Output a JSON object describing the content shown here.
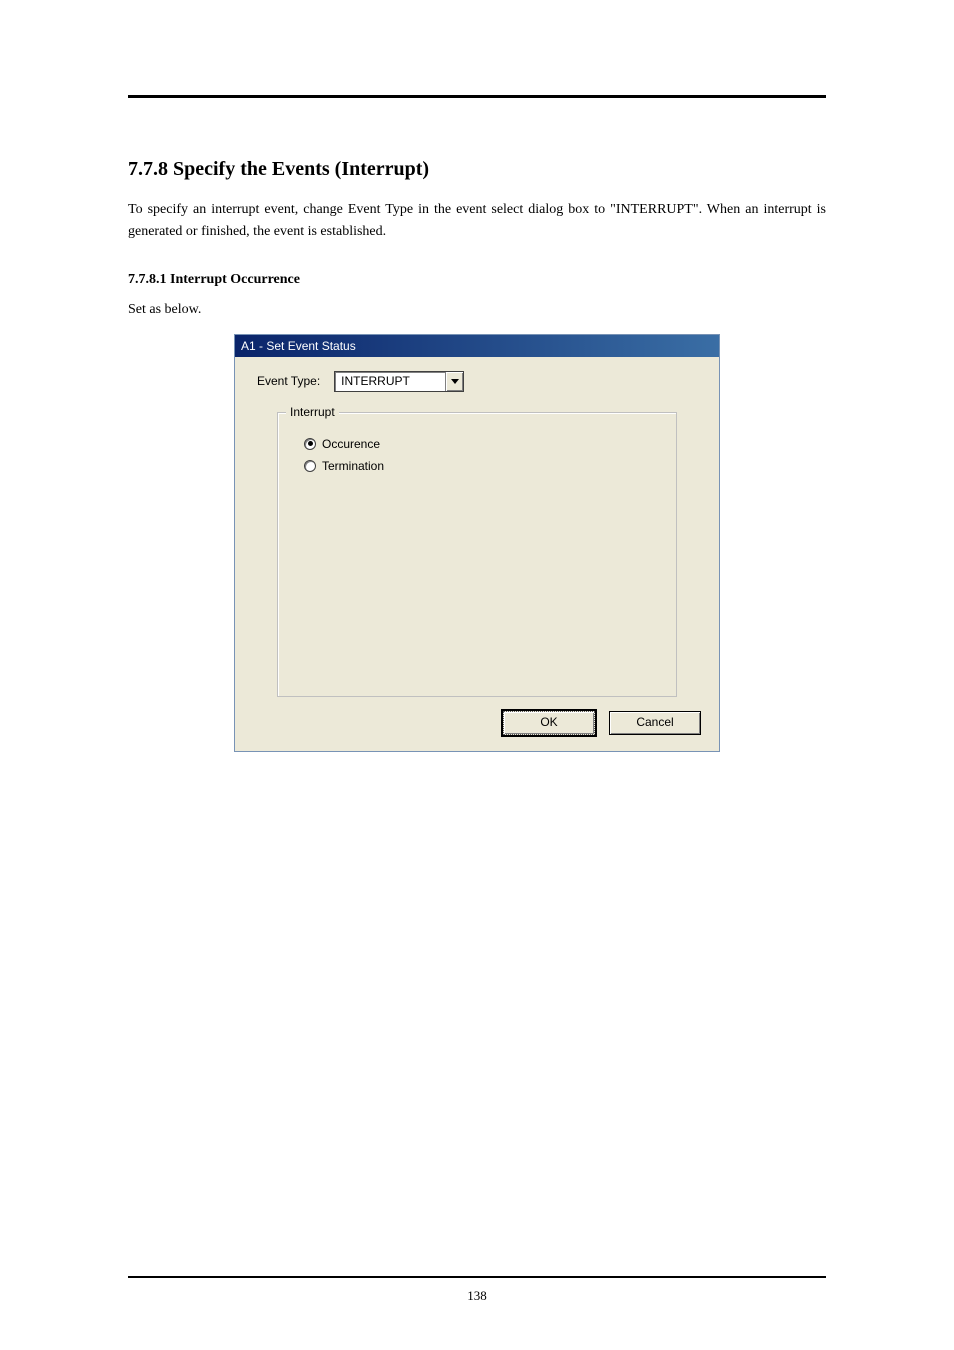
{
  "page": {
    "section_heading": "7.7.8 Specify the Events (Interrupt)",
    "body_text": "To specify an interrupt event, change Event Type in the event select dialog box to \"INTERRUPT\". When an interrupt is generated or finished, the event is established.",
    "sub_heading": "7.7.8.1 Interrupt Occurrence",
    "sub_text": "Set as below.",
    "page_number": "138"
  },
  "dialog": {
    "title": "A1 - Set Event Status",
    "event_type_label": "Event Type:",
    "event_type_value": "INTERRUPT",
    "group_label": "Interrupt",
    "radio": {
      "occurence": {
        "label": "Occurence",
        "checked": true
      },
      "termination": {
        "label": "Termination",
        "checked": false
      }
    },
    "buttons": {
      "ok": "OK",
      "cancel": "Cancel"
    }
  }
}
